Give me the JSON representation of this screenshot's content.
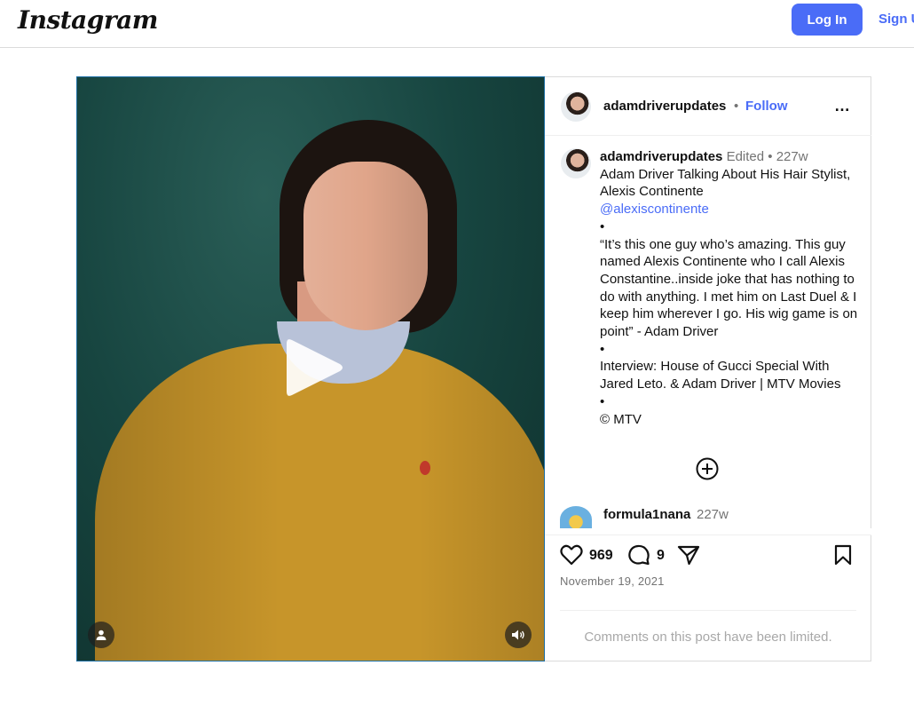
{
  "header": {
    "logo_text": "Instagram",
    "login_label": "Log In",
    "signup_label": "Sign Up"
  },
  "video": {
    "play_icon": "play-icon",
    "user_icon": "user-icon",
    "sound_icon": "speaker-icon"
  },
  "post_header": {
    "username": "adamdriverupdates",
    "separator": "•",
    "follow_label": "Follow",
    "more_icon": "…"
  },
  "caption": {
    "username": "adamdriverupdates",
    "edited": "Edited",
    "separator": "•",
    "age": "227w",
    "lines": [
      "Adam Driver Talking About His Hair Stylist, Alexis Continente",
      "@alexiscontinente",
      "•",
      "“It’s this one guy who’s amazing. This guy named Alexis Continente who I call Alexis Constantine..inside joke that has nothing to do with anything. I met him on Last Duel & I keep him wherever I go. His wig game is on point” - Adam Driver",
      "•",
      "Interview: House of Gucci Special With Jared Leto. & Adam Driver | MTV Movies",
      "•",
      "© MTV"
    ]
  },
  "load_more_icon": "plus-circle-icon",
  "comment": {
    "username": "formula1nana",
    "age": "227w"
  },
  "actions": {
    "like_count": "969",
    "comment_count": "9",
    "date": "November 19, 2021",
    "limited_text": "Comments on this post have been limited."
  }
}
